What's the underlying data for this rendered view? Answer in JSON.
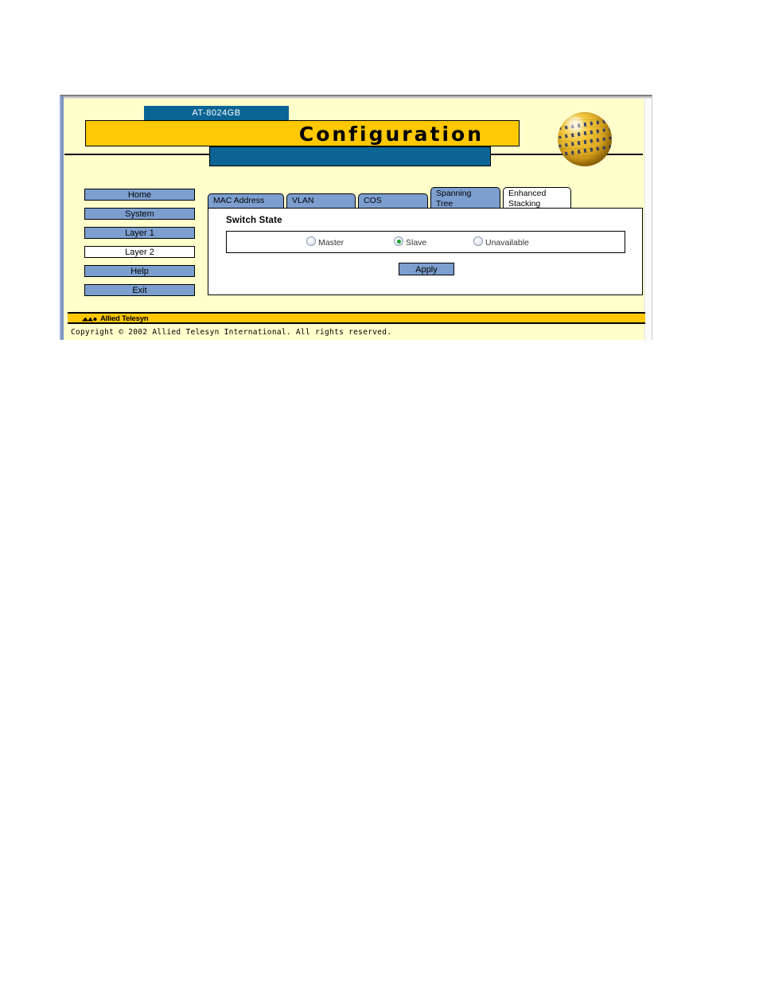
{
  "window": {
    "model_banner": "AT-8024GB",
    "page_title": "Configuration"
  },
  "sidebar": {
    "items": [
      {
        "label": "Home",
        "active": false
      },
      {
        "label": "System",
        "active": false
      },
      {
        "label": "Layer 1",
        "active": false
      },
      {
        "label": "Layer 2",
        "active": true
      },
      {
        "label": "Help",
        "active": false
      },
      {
        "label": "Exit",
        "active": false
      }
    ]
  },
  "tabs": [
    {
      "label": "MAC Address",
      "active": false
    },
    {
      "label": "VLAN",
      "active": false
    },
    {
      "label": "COS",
      "active": false
    },
    {
      "label": "Spanning\nTree",
      "active": false
    },
    {
      "label": "Enhanced\nStacking",
      "active": true
    }
  ],
  "main": {
    "section_title": "Switch State",
    "radio_group": {
      "name": "switch-state",
      "options": [
        {
          "label": "Master",
          "selected": false
        },
        {
          "label": "Slave",
          "selected": true
        },
        {
          "label": "Unavailable",
          "selected": false
        }
      ],
      "selected_value": "Slave"
    },
    "apply_label": "Apply"
  },
  "footer": {
    "logo_text": "Allied Telesyn",
    "copyright": "Copyright © 2002 Allied Telesyn International. All rights reserved."
  },
  "colors": {
    "page_background": "#ffffcc",
    "gold": "#ffc800",
    "blue_banner": "#0b6494",
    "button_blue": "#7d9fd0",
    "selected_radio_green": "#1f9d28",
    "text": "#000000"
  }
}
